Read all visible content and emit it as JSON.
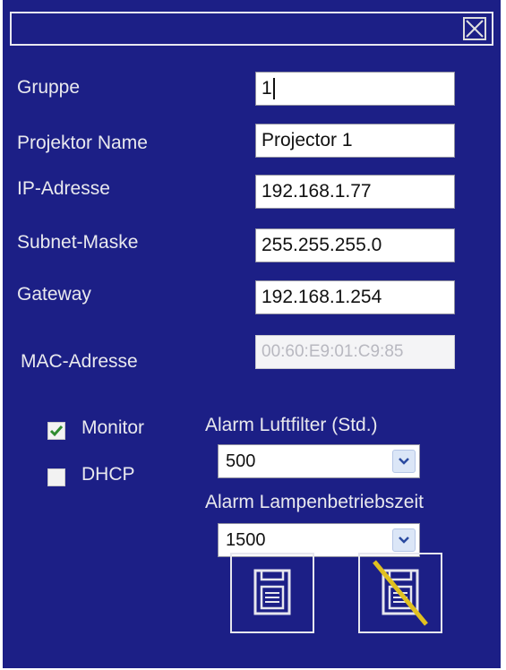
{
  "form": {
    "group_label": "Gruppe",
    "group_value": "1",
    "projector_name_label": "Projektor Name",
    "projector_name_value": "Projector 1",
    "ip_label": "IP-Adresse",
    "ip_value": "192.168.1.77",
    "subnet_label": "Subnet-Maske",
    "subnet_value": "255.255.255.0",
    "gateway_label": "Gateway",
    "gateway_value": "192.168.1.254",
    "mac_label": "MAC-Adresse",
    "mac_value": "00:60:E9:01:C9:85"
  },
  "options": {
    "monitor_label": "Monitor",
    "monitor_checked": true,
    "dhcp_label": "DHCP",
    "dhcp_checked": false,
    "filter_alarm_label": "Alarm Luftfilter (Std.)",
    "filter_alarm_value": "500",
    "lamp_alarm_label": "Alarm Lampenbetriebszeit",
    "lamp_alarm_value": "1500"
  },
  "icons": {
    "close": "close-icon",
    "save": "save-icon",
    "discard": "discard-icon",
    "checkmark": "checkmark-icon",
    "dropdown": "chevron-down-icon"
  },
  "colors": {
    "background": "#1c1f86",
    "label": "#e9e9ee",
    "check": "#2e8b2e",
    "strike": "#e0c020"
  }
}
